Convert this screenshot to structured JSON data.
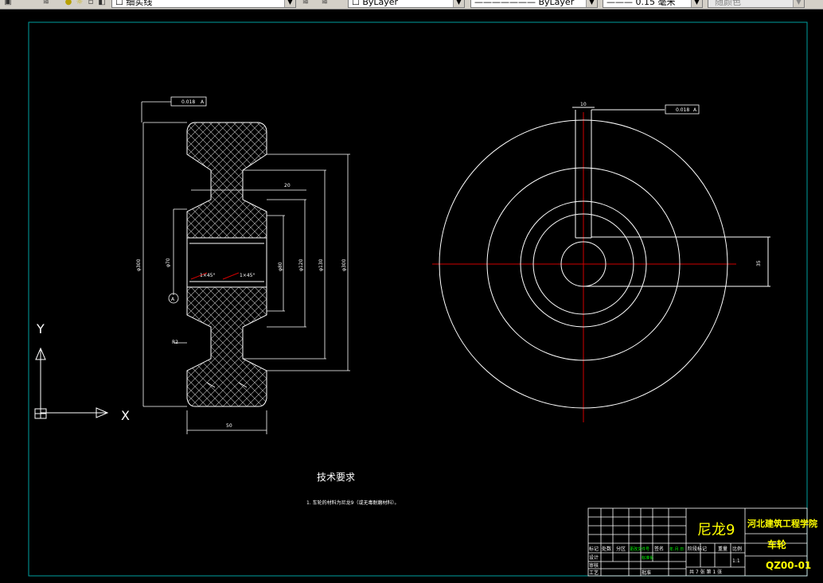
{
  "toolbar": {
    "layer_label": "细实线",
    "color_label": "ByLayer",
    "linetype_label": "ByLayer",
    "lineweight_label": "0.15 毫米",
    "plotstyle_label": "随颜色"
  },
  "drawing": {
    "tolerance_left": "0.018",
    "tolerance_left_ref": "A",
    "tolerance_right": "0.018",
    "tolerance_right_ref": "A",
    "dim_top_width": "20",
    "dim_phi_outer": "φ300",
    "dim_phi_bore": "φ70",
    "dim_phi_hub": "φ80",
    "dim_phi_mid": "φ120",
    "dim_phi_groove": "φ180",
    "dim_phi_groove2": "φ130",
    "chamfer_left": "1×45°",
    "chamfer_right": "1×45°",
    "datum_label": "A",
    "radius_label": "R2",
    "dim_bottom_width": "50",
    "keyway_width": "10",
    "keyway_depth": "35",
    "ucs_y": "Y",
    "ucs_x": "X"
  },
  "notes": {
    "title": "技术要求",
    "line1": "1. 车轮的材料为尼龙9（或无毒耐磨材料）。"
  },
  "title_block": {
    "material": "尼龙9",
    "school": "河北建筑工程学院",
    "part_name": "车轮",
    "drawing_no": "QZ00-01",
    "cells": {
      "biaoji": "标记",
      "chushu": "处数",
      "fenqu": "分区",
      "wenjian": "更改文件号",
      "qianming": "签名",
      "riqi": "年.月.日",
      "sheji": "设计",
      "biaozhunhua": "标准化",
      "jieduan": "阶段标记",
      "zhongliang": "重量",
      "bili": "比例",
      "shenhe": "审核",
      "gongyi": "工艺",
      "pizhun": "批准",
      "gong": "共 7 张  第 1 张",
      "scale": "1:1"
    }
  }
}
